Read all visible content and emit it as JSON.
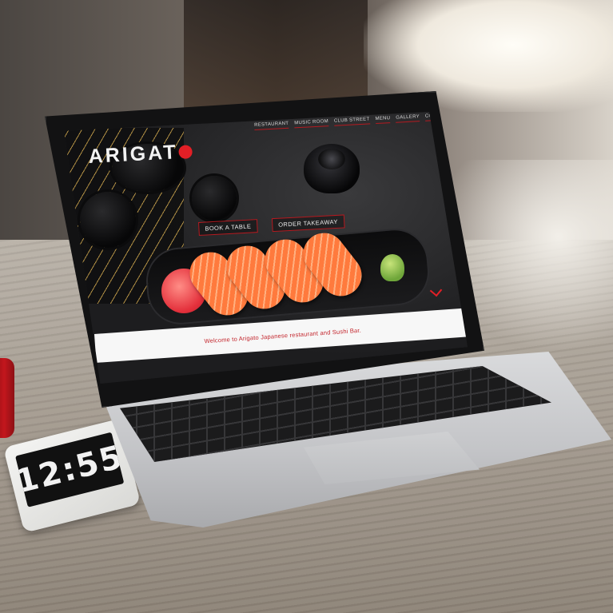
{
  "site": {
    "logo_text": "ARIGAT",
    "nav": [
      {
        "label": "RESTAURANT"
      },
      {
        "label": "MUSIC ROOM"
      },
      {
        "label": "CLUB STREET"
      },
      {
        "label": "MENU"
      },
      {
        "label": "GALLERY"
      },
      {
        "label": "CONTACT"
      }
    ],
    "cta": {
      "book_label": "BOOK A TABLE",
      "order_label": "ORDER TAKEAWAY"
    },
    "slider": {
      "count": 3,
      "active": 1
    },
    "welcome_text": "Welcome to Arigato Japanese restaurant and Sushi Bar."
  },
  "phone": {
    "time": "12:55"
  },
  "colors": {
    "brand_red": "#e21f26",
    "welcome_text": "#c3252c",
    "cup_red": "#c3161d"
  }
}
